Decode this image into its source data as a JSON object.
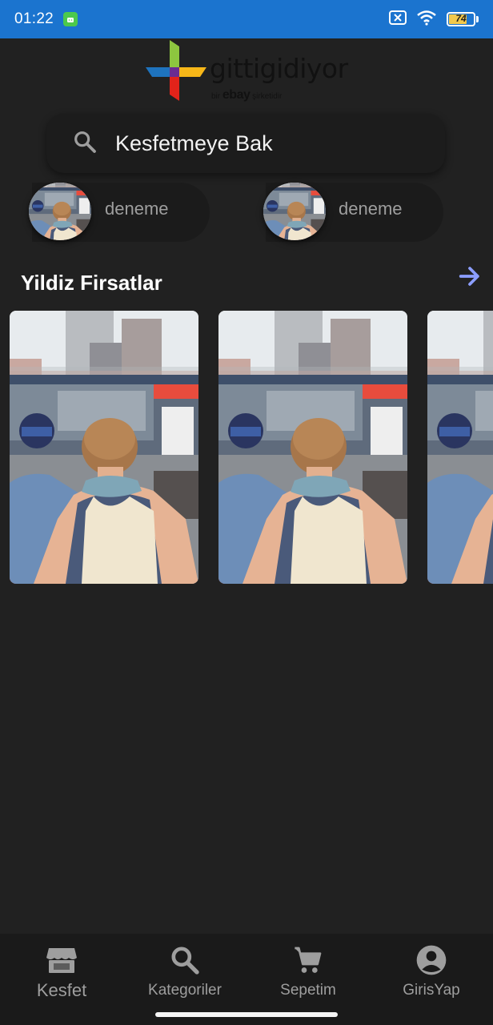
{
  "status_bar": {
    "time": "01:22",
    "battery_level": "74",
    "battery_fraction": 0.74,
    "app_icon": "android-app-icon",
    "icons": [
      "sim-x-icon",
      "wifi-icon",
      "battery-icon"
    ]
  },
  "header": {
    "logo_name": "gittigidiyor",
    "logo_sub_pre": "bir",
    "logo_sub_brand": "ebay",
    "logo_sub_post": "şirketidir"
  },
  "search": {
    "icon": "search-icon",
    "text": "Kesfetmeye Bak"
  },
  "chips": [
    {
      "label": "deneme"
    },
    {
      "label": "deneme"
    }
  ],
  "section": {
    "title": "Yildiz Firsatlar",
    "arrow_icon": "arrow-right-icon",
    "accent_color": "#8c9eff"
  },
  "products": [
    {
      "image": "street-scene-photo"
    },
    {
      "image": "street-scene-photo"
    },
    {
      "image": "street-scene-photo"
    }
  ],
  "bottom_nav": {
    "items": [
      {
        "label": "Kesfet",
        "icon": "store-icon"
      },
      {
        "label": "Kategoriler",
        "icon": "search-icon"
      },
      {
        "label": "Sepetim",
        "icon": "cart-icon"
      },
      {
        "label": "GirisYap",
        "icon": "account-circle-icon"
      }
    ]
  },
  "colors": {
    "background": "#212121",
    "status_bar": "#1b74cf",
    "nav_bar": "#1a1a1a",
    "muted_text": "#9e9e9e"
  }
}
